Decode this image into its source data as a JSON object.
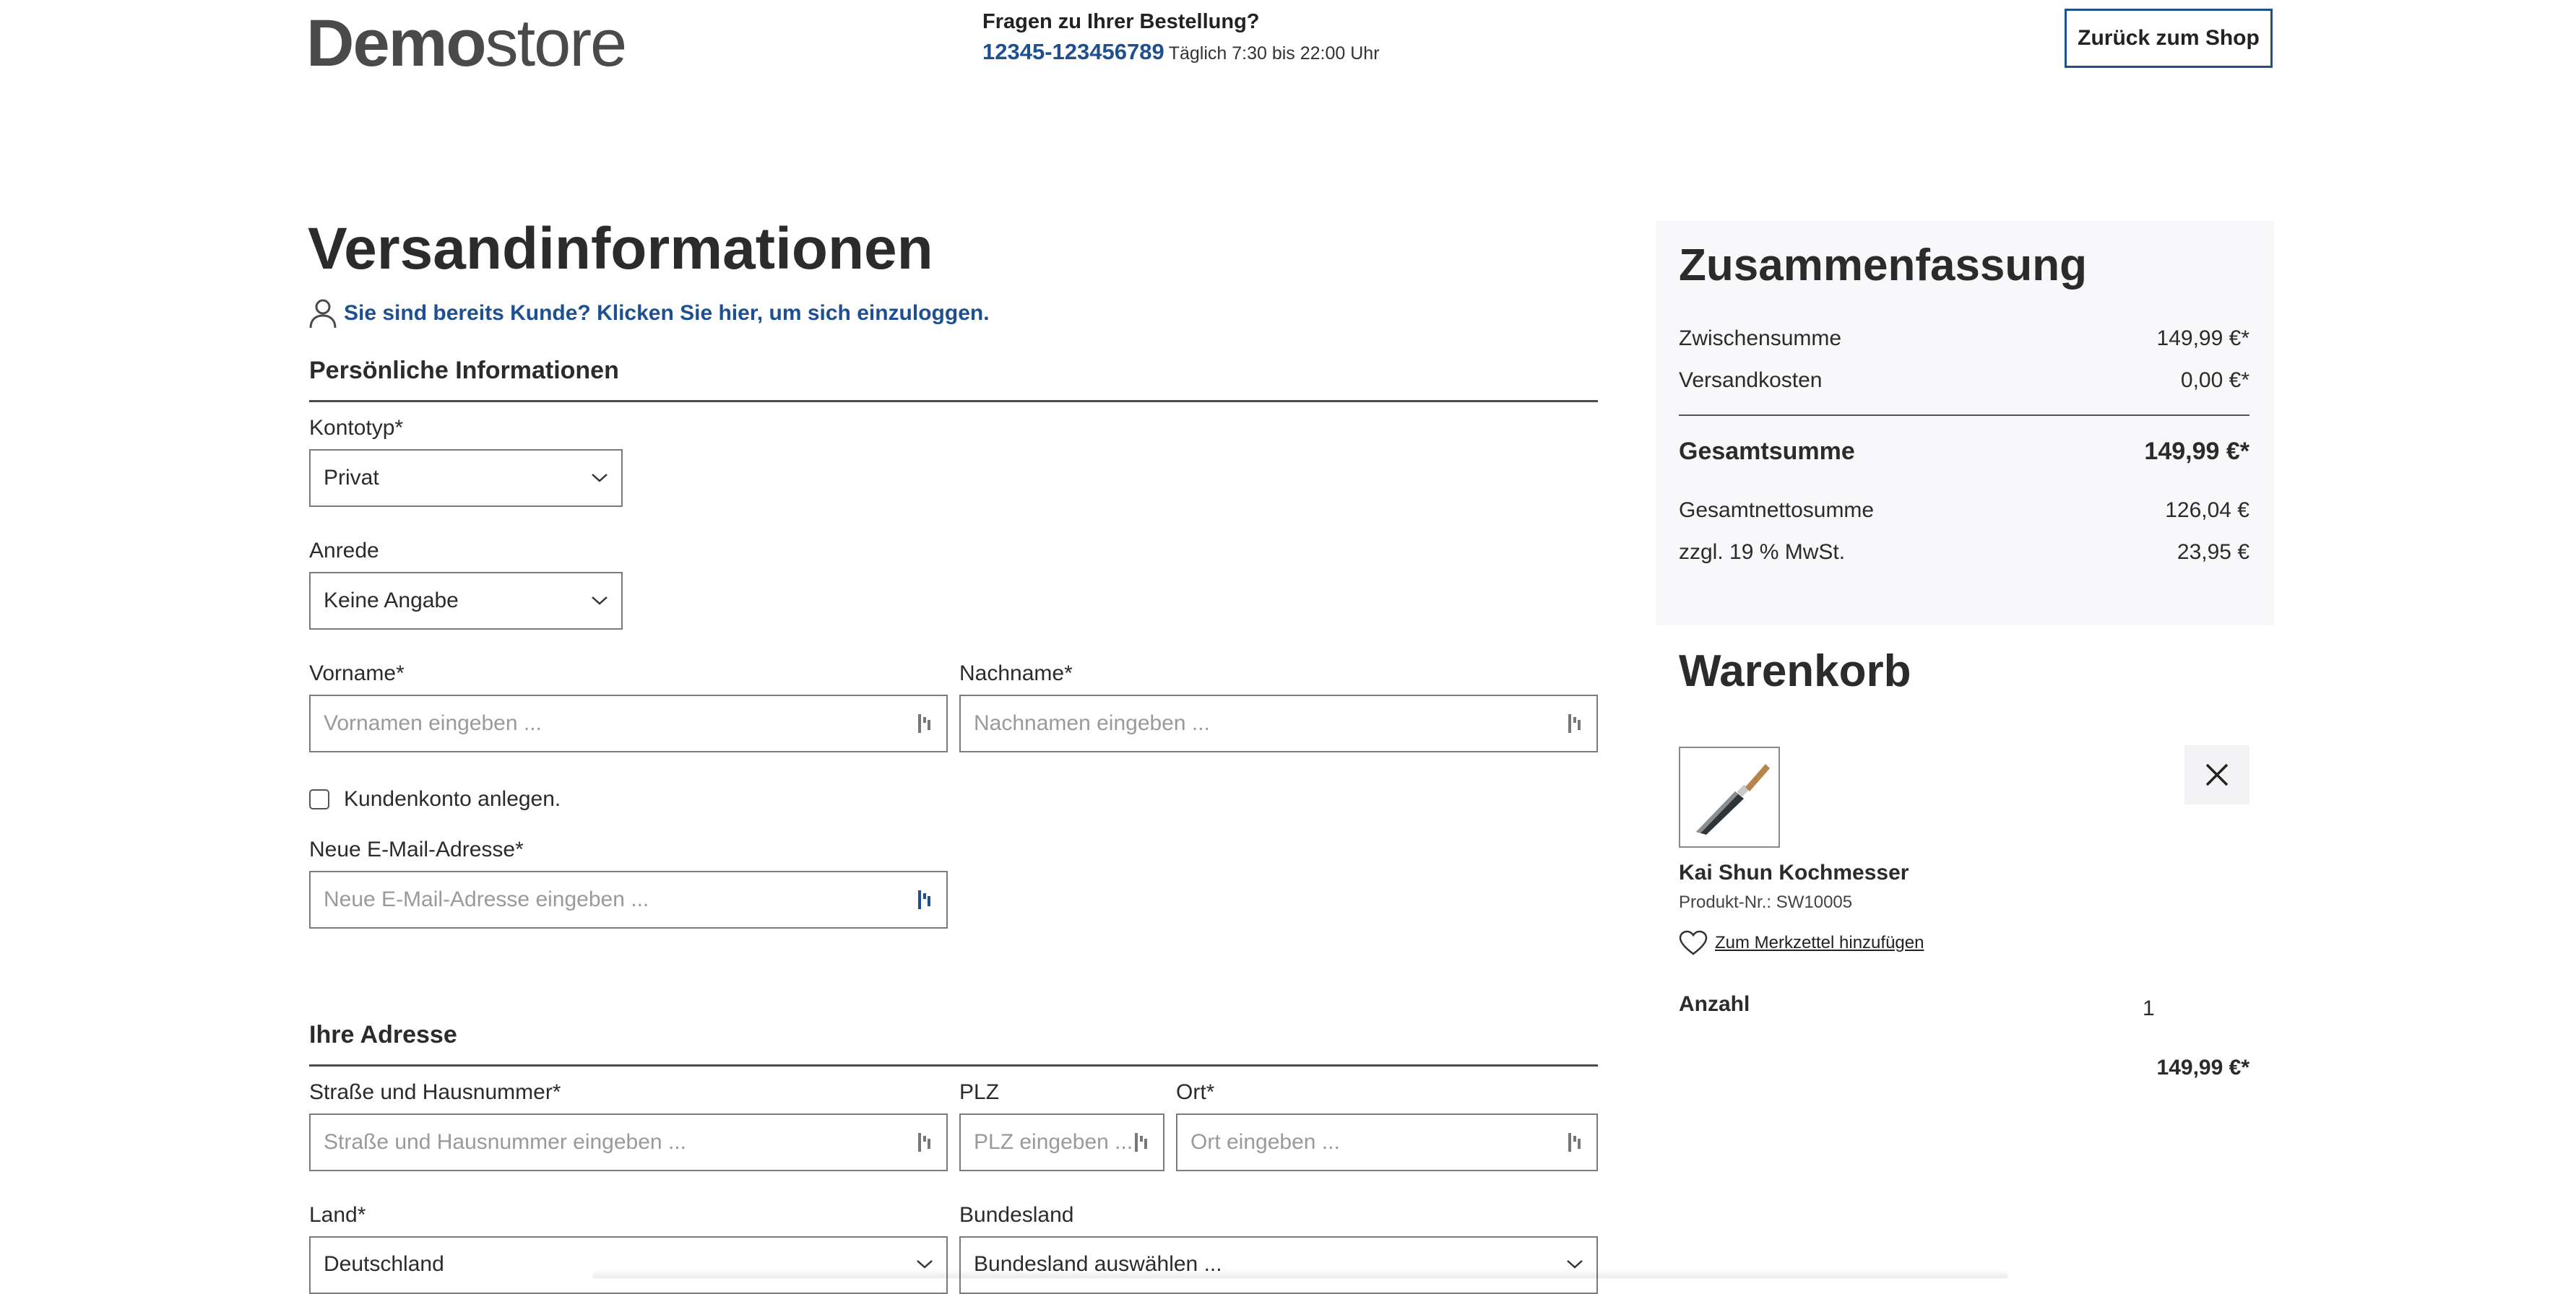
{
  "header": {
    "logo_bold": "Demo",
    "logo_light": "store",
    "hotline_title": "Fragen zu Ihrer Bestellung?",
    "hotline_phone": "12345-123456789",
    "hotline_hours": "Täglich 7:30 bis 22:00 Uhr",
    "back_button": "Zurück zum Shop"
  },
  "page": {
    "title": "Versandinformationen",
    "login_link": "Sie sind bereits Kunde? Klicken Sie hier, um sich einzuloggen."
  },
  "personal": {
    "section_title": "Persönliche Informationen",
    "account_type": {
      "label": "Kontotyp*",
      "value": "Privat"
    },
    "salutation": {
      "label": "Anrede",
      "value": "Keine Angabe"
    },
    "first_name": {
      "label": "Vorname*",
      "placeholder": "Vornamen eingeben ..."
    },
    "last_name": {
      "label": "Nachname*",
      "placeholder": "Nachnamen eingeben ..."
    },
    "create_account": {
      "label": "Kundenkonto anlegen.",
      "checked": false
    },
    "email": {
      "label": "Neue E-Mail-Adresse*",
      "placeholder": "Neue E-Mail-Adresse eingeben ..."
    }
  },
  "address": {
    "section_title": "Ihre Adresse",
    "street": {
      "label": "Straße und Hausnummer*",
      "placeholder": "Straße und Hausnummer eingeben ..."
    },
    "zip": {
      "label": "PLZ",
      "placeholder": "PLZ eingeben ..."
    },
    "city": {
      "label": "Ort*",
      "placeholder": "Ort eingeben ..."
    },
    "country": {
      "label": "Land*",
      "value": "Deutschland"
    },
    "state": {
      "label": "Bundesland",
      "value": "Bundesland auswählen ..."
    }
  },
  "summary": {
    "title": "Zusammenfassung",
    "subtotal_label": "Zwischensumme",
    "subtotal_value": "149,99 €*",
    "shipping_label": "Versandkosten",
    "shipping_value": "0,00 €*",
    "total_label": "Gesamtsumme",
    "total_value": "149,99 €*",
    "net_label": "Gesamtnettosumme",
    "net_value": "126,04 €",
    "vat_label": "zzgl. 19 % MwSt.",
    "vat_value": "23,95 €"
  },
  "cart": {
    "title": "Warenkorb",
    "item": {
      "name": "Kai Shun Kochmesser",
      "product_number": "Produkt-Nr.: SW10005",
      "wishlist_link": "Zum Merkzettel hinzufügen",
      "quantity_label": "Anzahl",
      "quantity": "1",
      "price": "149,99 €*"
    }
  },
  "colors": {
    "accent": "#1d4f91",
    "text": "#2b2b2b",
    "summary_bg": "#f8f7f9"
  }
}
